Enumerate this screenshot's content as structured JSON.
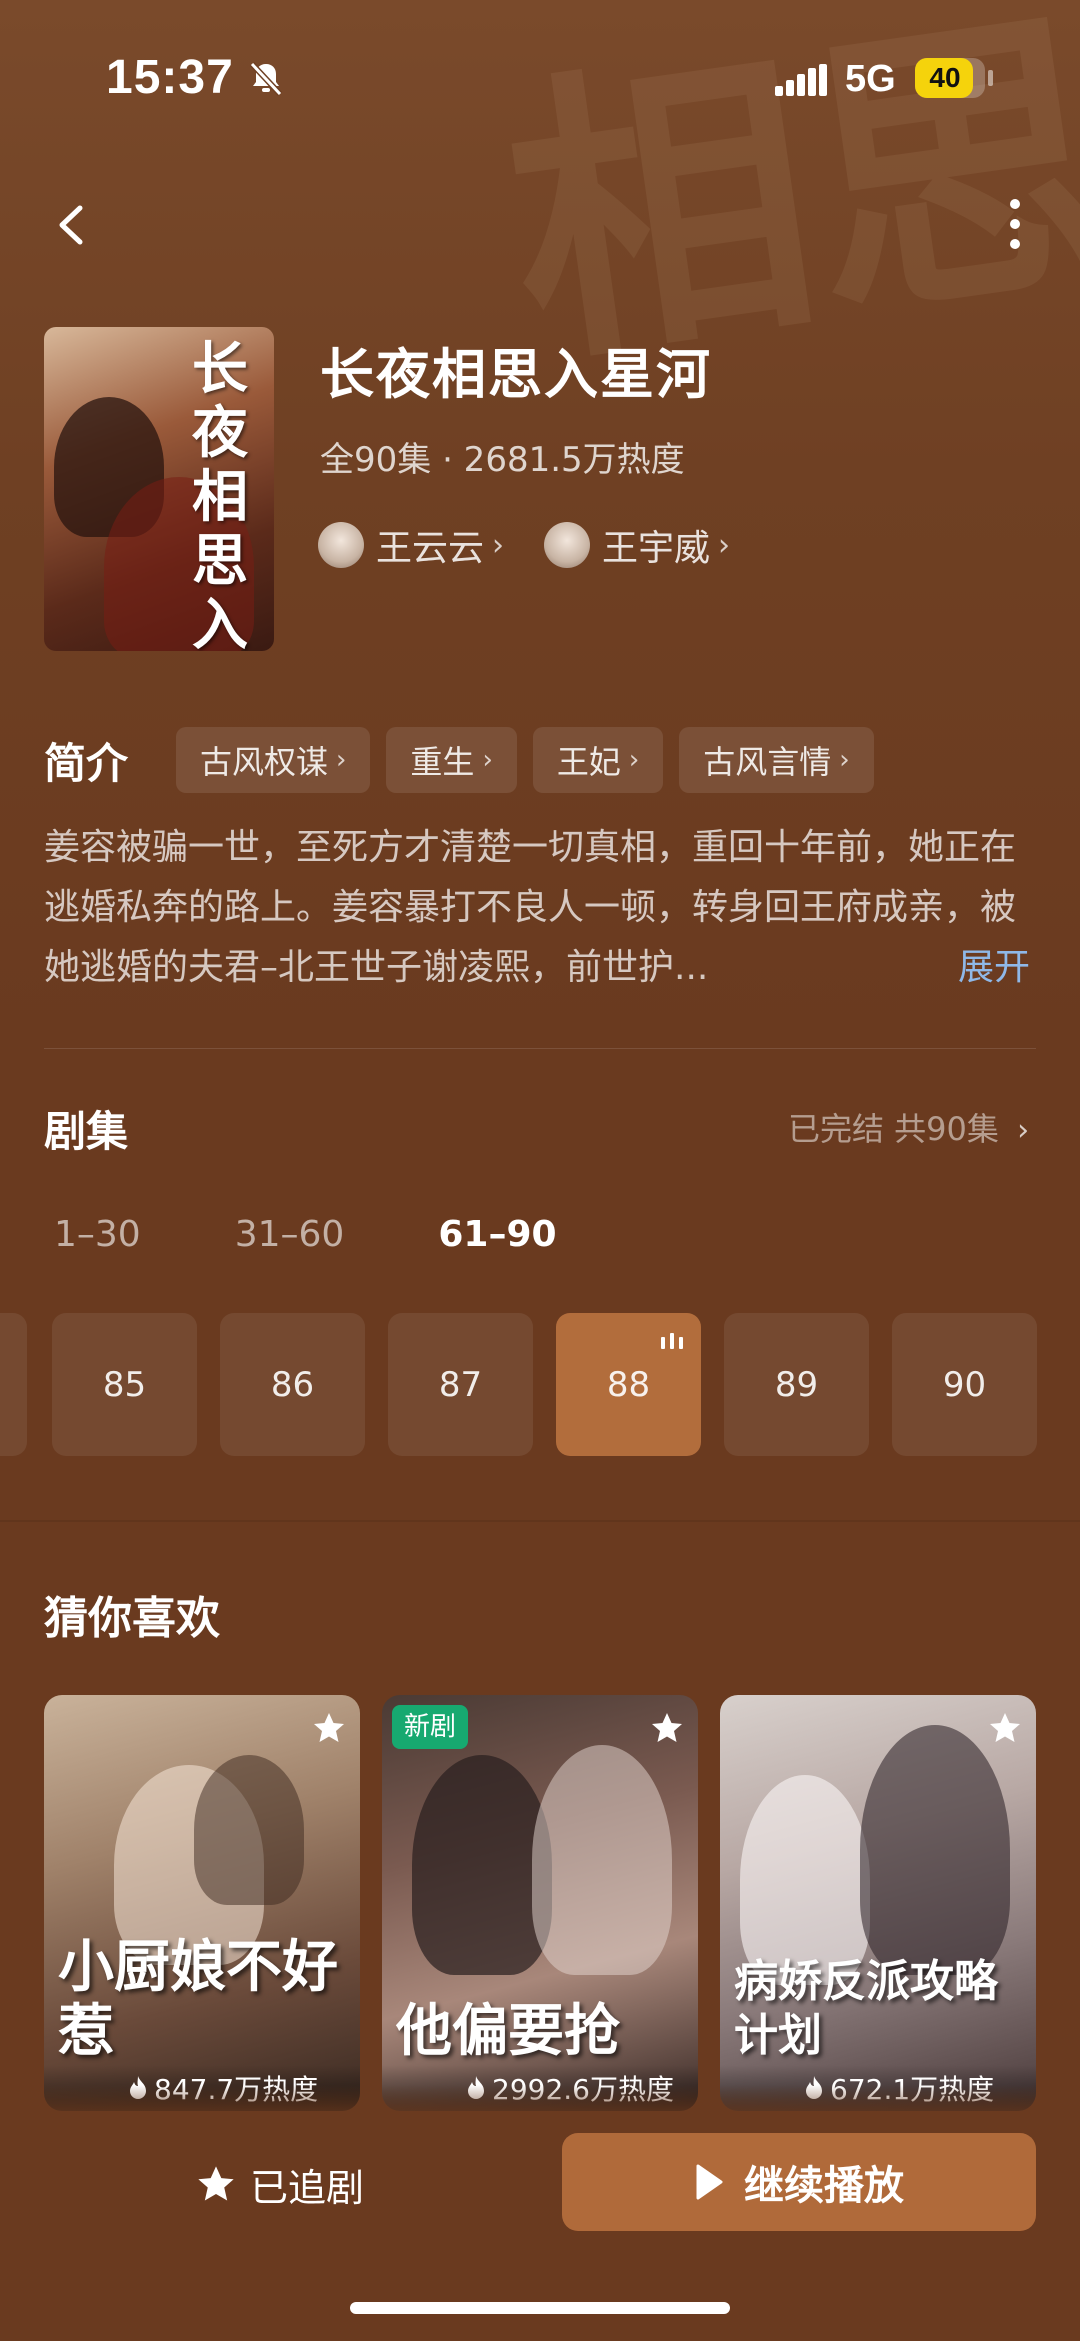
{
  "status_bar": {
    "time": "15:37",
    "network": "5G",
    "battery": "40",
    "battery_level": 0.4
  },
  "drama": {
    "title": "长夜相思入星河",
    "poster_calligraphy": "长夜相思入星河",
    "meta": "全90集 · 2681.5万热度",
    "actors": [
      {
        "name": "王云云"
      },
      {
        "name": "王宇威"
      }
    ]
  },
  "intro": {
    "label": "简介",
    "tags": [
      "古风权谋",
      "重生",
      "王妃",
      "古风言情"
    ],
    "description": "姜容被骗一世，至死方才清楚一切真相，重回十年前，她正在逃婚私奔的路上。姜容暴打不良人一顿，转身回王府成亲，被她逃婚的夫君–北王世子谢凌熙，前世护...",
    "expand": "展开"
  },
  "episodes": {
    "title": "剧集",
    "summary": "已完结 共90集",
    "ranges": [
      "1–30",
      "31–60",
      "61–90"
    ],
    "active_range": "61–90",
    "items": [
      "85",
      "86",
      "87",
      "88",
      "89",
      "90"
    ],
    "current": "88"
  },
  "recommendations": {
    "title": "猜你喜欢",
    "cards": [
      {
        "calligraphy": "小厨娘不好惹",
        "heat": "847.7万热度",
        "badge": ""
      },
      {
        "calligraphy": "他偏要抢",
        "heat": "2992.6万热度",
        "badge": "新剧"
      },
      {
        "calligraphy": "病娇反派攻略计划",
        "heat": "672.1万热度",
        "badge": ""
      }
    ]
  },
  "actions": {
    "follow": "已追剧",
    "play": "继续播放"
  },
  "colors": {
    "background": "#6a3a1f",
    "accent": "#b06a3a",
    "badge": "#17a970",
    "link": "#8fb8e8"
  }
}
